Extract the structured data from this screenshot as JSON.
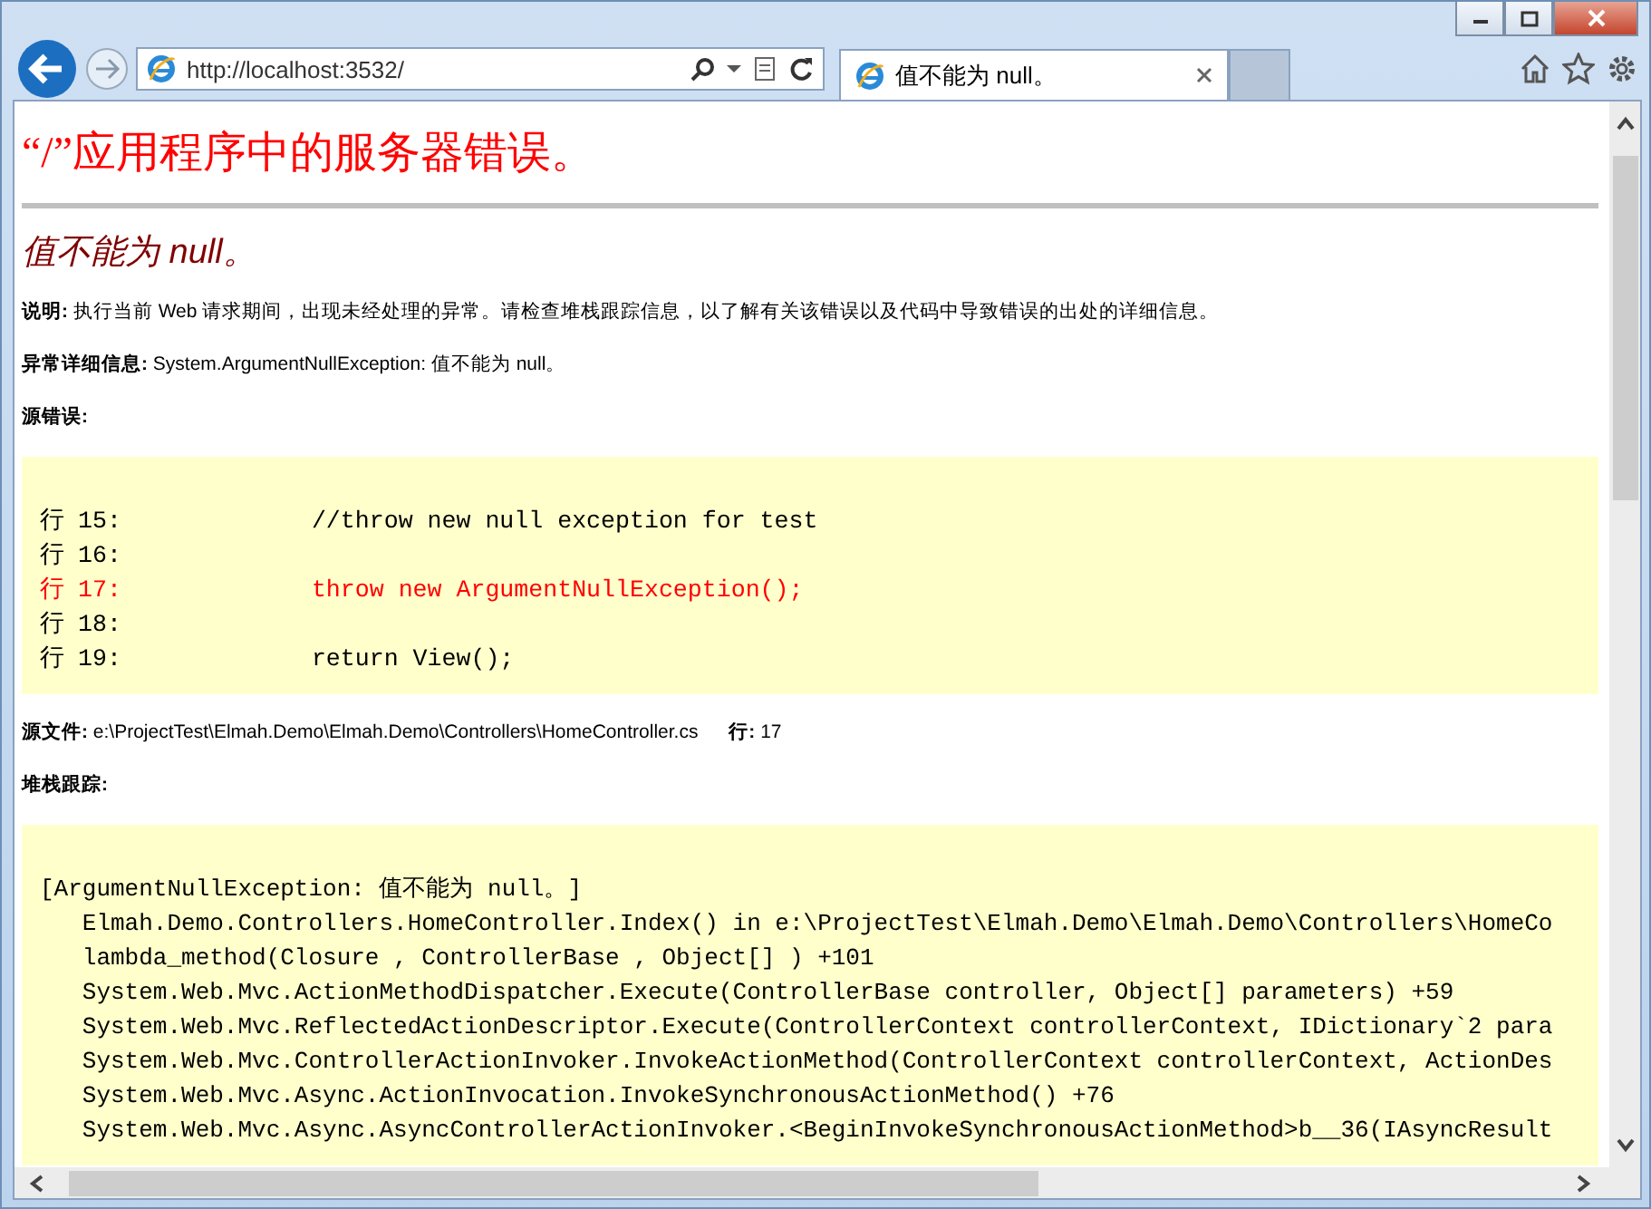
{
  "browser": {
    "address": "http://localhost:3532/",
    "tab_title": "值不能为 null。"
  },
  "page": {
    "title": "“/”应用程序中的服务器错误。",
    "message": "值不能为 null。",
    "description_label": "说明:",
    "description": "执行当前 Web 请求期间，出现未经处理的异常。请检查堆栈跟踪信息，以了解有关该错误以及代码中导致错误的出处的详细信息。",
    "exception_label": "异常详细信息:",
    "exception": "System.ArgumentNullException: 值不能为 null。",
    "source_error_label": "源错误:",
    "source_lines": [
      {
        "number": "行 15:",
        "code": "            //throw new null exception for test",
        "selected": false
      },
      {
        "number": "行 16:",
        "selected": false
      },
      {
        "number": "行 17:",
        "code": "            throw new ArgumentNullException();",
        "selected": true
      },
      {
        "number": "行 18:",
        "selected": false
      },
      {
        "number": "行 19:",
        "code": "            return View();",
        "selected": false
      }
    ],
    "source_file_label": "源文件:",
    "source_file": "e:\\ProjectTest\\Elmah.Demo\\Elmah.Demo\\Controllers\\HomeController.cs",
    "line_label": "行:",
    "line": "17",
    "stack_label": "堆栈跟踪:",
    "stack_trace": [
      "[ArgumentNullException: 值不能为 null。]",
      "   Elmah.Demo.Controllers.HomeController.Index() in e:\\ProjectTest\\Elmah.Demo\\Elmah.Demo\\Controllers\\HomeCo",
      "   lambda_method(Closure , ControllerBase , Object[] ) +101",
      "   System.Web.Mvc.ActionMethodDispatcher.Execute(ControllerBase controller, Object[] parameters) +59",
      "   System.Web.Mvc.ReflectedActionDescriptor.Execute(ControllerContext controllerContext, IDictionary`2 para",
      "   System.Web.Mvc.ControllerActionInvoker.InvokeActionMethod(ControllerContext controllerContext, ActionDes",
      "   System.Web.Mvc.Async.ActionInvocation.InvokeSynchronousActionMethod() +76",
      "   System.Web.Mvc.Async.AsyncControllerActionInvoker.<BeginInvokeSynchronousActionMethod>b__36(IAsyncResult"
    ]
  }
}
